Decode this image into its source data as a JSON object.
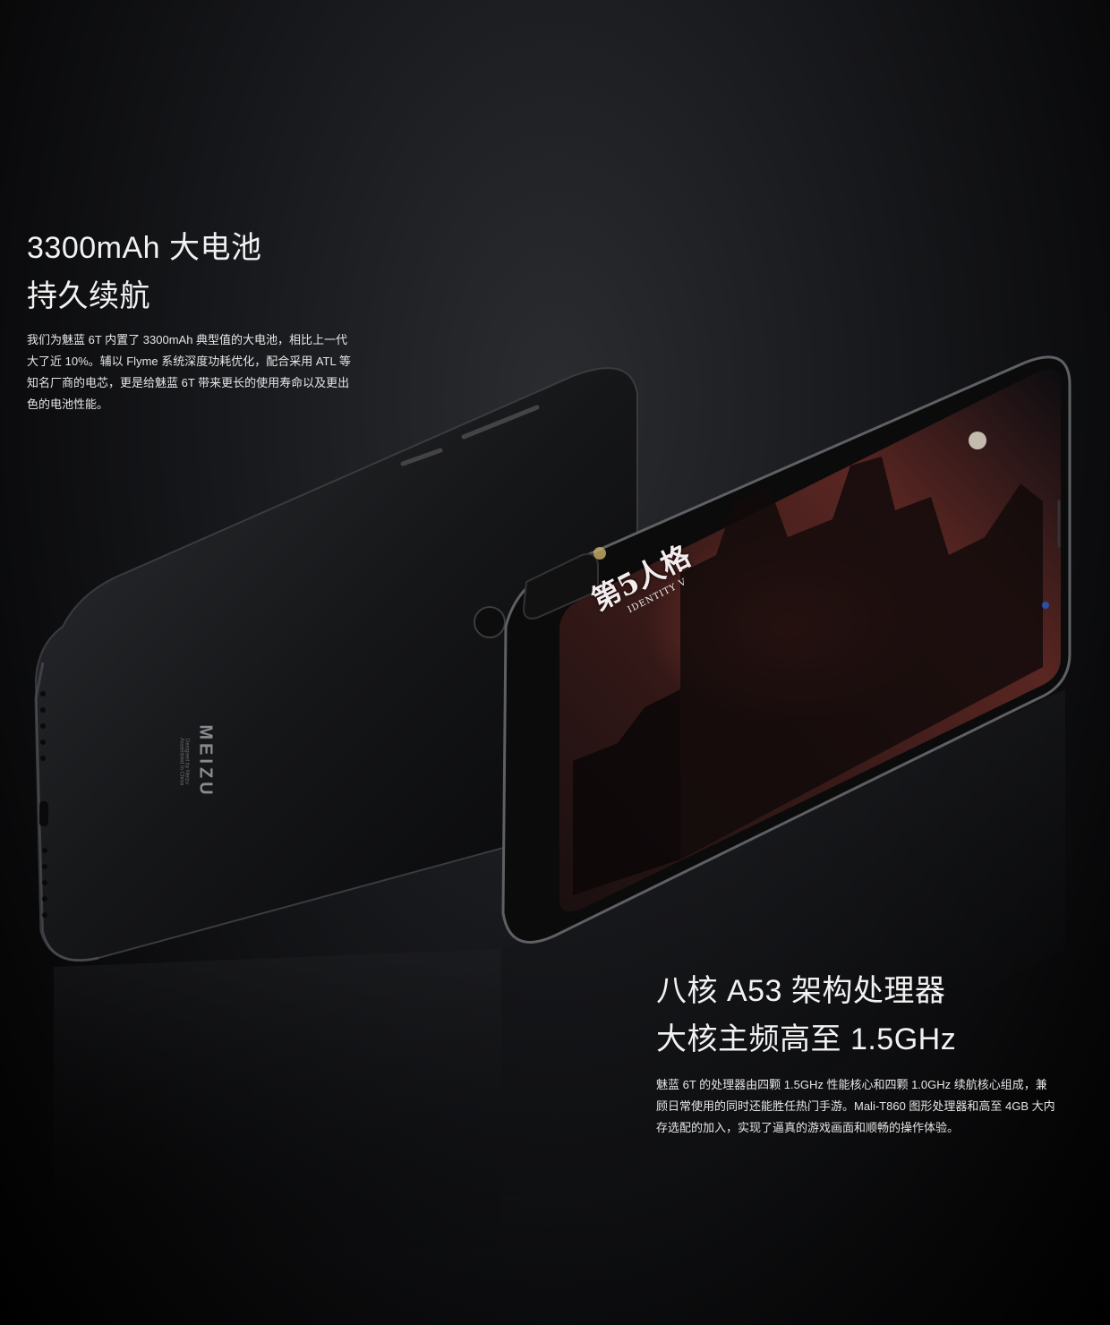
{
  "battery": {
    "heading_line1": "3300mAh 大电池",
    "heading_line2": "持久续航",
    "body_lines": [
      "我们为魅蓝 6T 内置了 3300mAh 典型值的大电池，相比上一代",
      "大了近 10%。辅以 Flyme 系统深度功耗优化，配合采用 ATL 等",
      "知名厂商的电芯，更是给魅蓝 6T 带来更长的使用寿命以及更出",
      "色的电池性能。"
    ]
  },
  "processor": {
    "heading_line1": "八核 A53 架构处理器",
    "heading_line2": "大核主频高至 1.5GHz",
    "body_lines": [
      "魅蓝 6T 的处理器由四颗 1.5GHz 性能核心和四颗 1.0GHz 续航核心组成，兼",
      "顾日常使用的同时还能胜任热门手游。Mali-T860 图形处理器和高至 4GB 大内",
      "存选配的加入，实现了逼真的游戏画面和顺畅的操作体验。"
    ]
  },
  "phone_back": {
    "brand_logo": "MEIZU",
    "fine_print_lines": [
      "Designed by Meizu",
      "Assembled in China"
    ]
  },
  "game_logo": {
    "title": "第5人格",
    "subtitle": "IDENTITY V"
  }
}
